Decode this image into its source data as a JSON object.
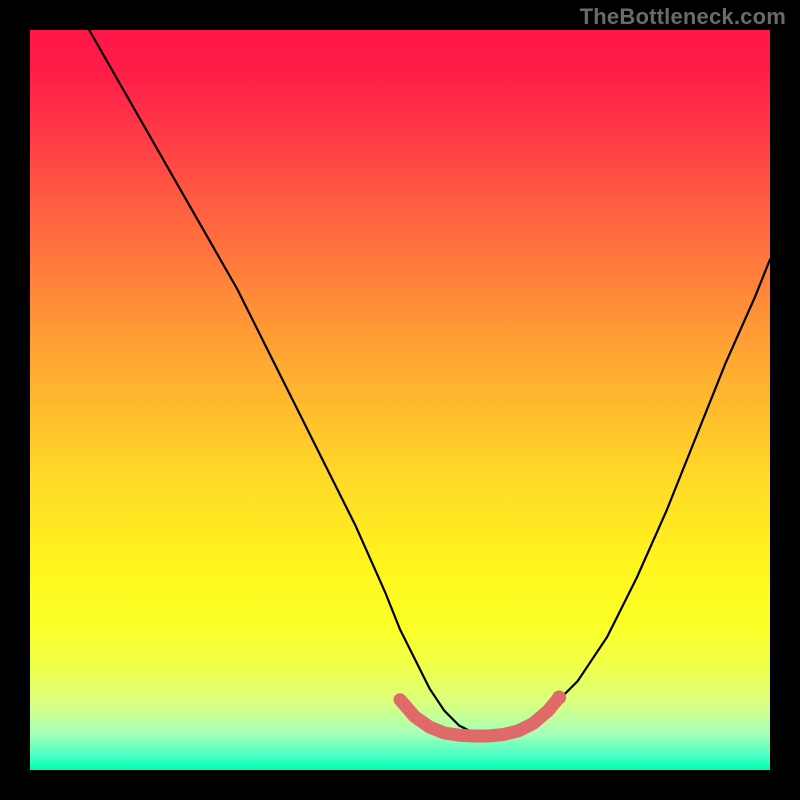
{
  "watermark": {
    "text": "TheBottleneck.com"
  },
  "chart_data": {
    "type": "line",
    "title": "",
    "xlabel": "",
    "ylabel": "",
    "xlim": [
      0,
      100
    ],
    "ylim": [
      0,
      100
    ],
    "grid": false,
    "legend": false,
    "annotations": [],
    "left_curve": {
      "name": "left-branch",
      "x": [
        8,
        12,
        16,
        20,
        24,
        28,
        32,
        36,
        40,
        44,
        48,
        50,
        52,
        54,
        56,
        58,
        60,
        61
      ],
      "y": [
        100,
        93,
        86,
        79,
        72,
        65,
        57,
        49,
        41,
        33,
        24,
        19,
        15,
        11,
        8,
        6,
        5,
        5
      ]
    },
    "right_curve": {
      "name": "right-branch",
      "x": [
        61,
        64,
        67,
        70,
        74,
        78,
        82,
        86,
        90,
        94,
        98,
        100
      ],
      "y": [
        5,
        5,
        6,
        8,
        12,
        18,
        26,
        35,
        45,
        55,
        64,
        69
      ]
    },
    "highlight_band": {
      "name": "optimal-zone",
      "color": "#e06a6a",
      "points": [
        {
          "x": 50,
          "y": 9.5
        },
        {
          "x": 52,
          "y": 7.2
        },
        {
          "x": 54,
          "y": 5.8
        },
        {
          "x": 56,
          "y": 5.0
        },
        {
          "x": 58,
          "y": 4.7
        },
        {
          "x": 60,
          "y": 4.6
        },
        {
          "x": 62,
          "y": 4.6
        },
        {
          "x": 64,
          "y": 4.8
        },
        {
          "x": 66,
          "y": 5.3
        },
        {
          "x": 68,
          "y": 6.3
        },
        {
          "x": 70,
          "y": 8.0
        },
        {
          "x": 71.5,
          "y": 9.8
        }
      ]
    },
    "background_gradient": {
      "stops": [
        {
          "pos": 0,
          "color": "#ff1648"
        },
        {
          "pos": 14,
          "color": "#ff3a47"
        },
        {
          "pos": 43,
          "color": "#ffa233"
        },
        {
          "pos": 72,
          "color": "#fff41e"
        },
        {
          "pos": 91,
          "color": "#d8ff80"
        },
        {
          "pos": 100,
          "color": "#00ffb0"
        }
      ]
    }
  }
}
